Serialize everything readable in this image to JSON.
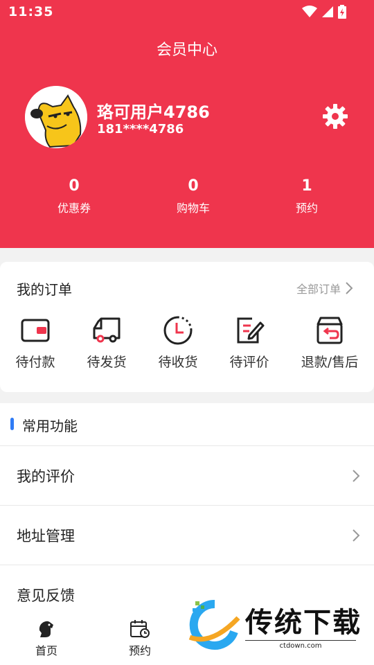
{
  "status_bar": {
    "time": "11:35"
  },
  "header": {
    "title": "会员中心",
    "user_name": "珞可用户4786",
    "user_phone": "181****4786",
    "stats": [
      {
        "value": "0",
        "label": "优惠券"
      },
      {
        "value": "0",
        "label": "购物车"
      },
      {
        "value": "1",
        "label": "预约"
      }
    ]
  },
  "orders": {
    "title": "我的订单",
    "all_label": "全部订单",
    "items": [
      {
        "label": "待付款",
        "icon": "wallet-icon"
      },
      {
        "label": "待发货",
        "icon": "truck-icon"
      },
      {
        "label": "待收货",
        "icon": "clock-icon"
      },
      {
        "label": "待评价",
        "icon": "edit-note-icon"
      },
      {
        "label": "退款/售后",
        "icon": "return-box-icon"
      }
    ]
  },
  "functions": {
    "title": "常用功能",
    "rows": [
      {
        "label": "我的评价"
      },
      {
        "label": "地址管理"
      },
      {
        "label": "意见反馈"
      }
    ]
  },
  "tabbar": {
    "tabs": [
      {
        "label": "首页",
        "icon": "dog-icon"
      },
      {
        "label": "预约",
        "icon": "calendar-icon"
      }
    ]
  },
  "watermark": {
    "text": "传统下载",
    "sub": "ctdown.com"
  },
  "colors": {
    "accent": "#ef354d",
    "marker": "#2f7bf5"
  }
}
